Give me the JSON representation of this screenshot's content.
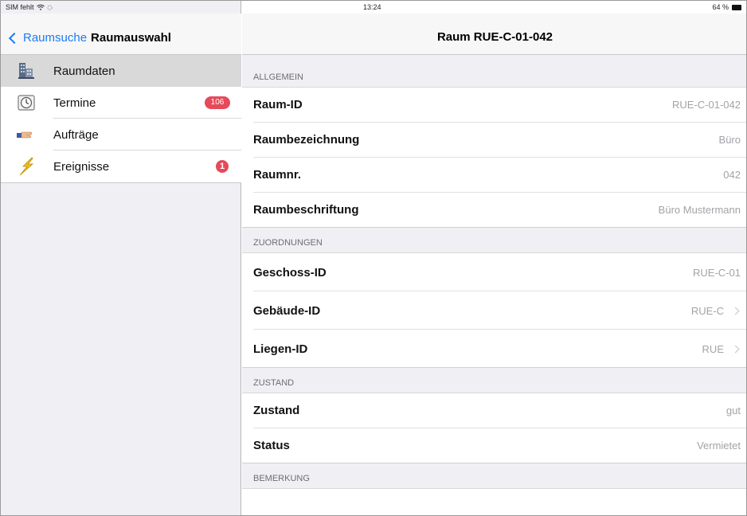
{
  "status_bar": {
    "carrier": "SIM fehlt",
    "time": "13:24",
    "battery": "64 %"
  },
  "left": {
    "back_label": "Raumsuche",
    "title": "Raumauswahl",
    "menu": [
      {
        "label": "Raumdaten",
        "icon": "building-icon"
      },
      {
        "label": "Termine",
        "icon": "clock-icon",
        "badge": "106"
      },
      {
        "label": "Aufträge",
        "icon": "pointing-hand-icon"
      },
      {
        "label": "Ereignisse",
        "icon": "lightning-icon",
        "badge": "1"
      }
    ]
  },
  "right": {
    "title": "Raum RUE-C-01-042",
    "sections": {
      "allgemein": {
        "header": "ALLGEMEIN",
        "rows": [
          {
            "label": "Raum-ID",
            "value": "RUE-C-01-042"
          },
          {
            "label": "Raumbezeichnung",
            "value": "Büro"
          },
          {
            "label": "Raumnr.",
            "value": "042"
          },
          {
            "label": "Raumbeschriftung",
            "value": "Büro Mustermann"
          }
        ]
      },
      "zuordnungen": {
        "header": "ZUORDNUNGEN",
        "rows": [
          {
            "label": "Geschoss-ID",
            "value": "RUE-C-01"
          },
          {
            "label": "Gebäude-ID",
            "value": "RUE-C"
          },
          {
            "label": "Liegen-ID",
            "value": "RUE"
          }
        ]
      },
      "zustand": {
        "header": "ZUSTAND",
        "rows": [
          {
            "label": "Zustand",
            "value": "gut"
          },
          {
            "label": "Status",
            "value": "Vermietet"
          }
        ]
      },
      "bemerkung": {
        "header": "BEMERKUNG"
      }
    }
  },
  "colors": {
    "accent": "#1a7cf5",
    "badge": "#e64a5a",
    "selected_row": "#d9d9d9",
    "group_background": "#efeff4"
  }
}
